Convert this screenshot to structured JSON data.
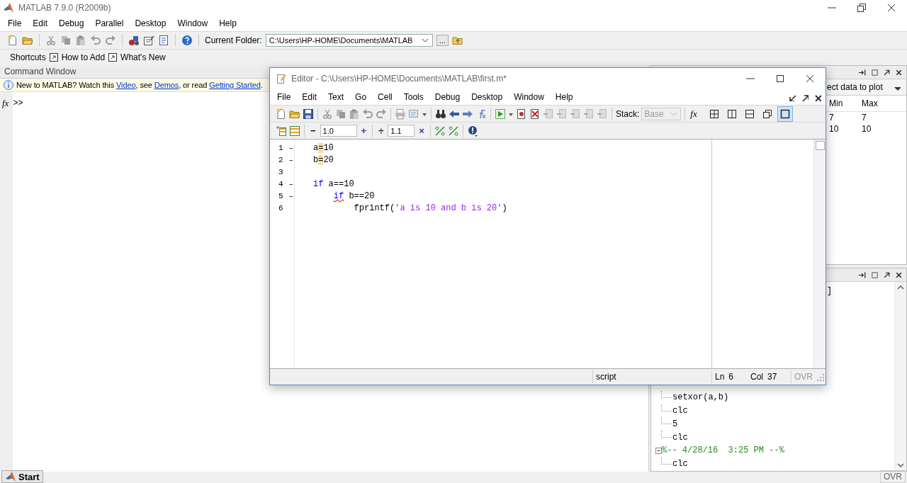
{
  "window": {
    "title": "MATLAB  7.9.0 (R2009b)"
  },
  "menu": [
    "File",
    "Edit",
    "Debug",
    "Parallel",
    "Desktop",
    "Window",
    "Help"
  ],
  "toolbar": {
    "current_folder_label": "Current Folder:",
    "current_folder": "C:\\Users\\HP-HOME\\Documents\\MATLAB",
    "browse": "..."
  },
  "shortcuts": {
    "label": "Shortcuts",
    "items": [
      "How to Add",
      "What's New"
    ]
  },
  "command_window": {
    "title": "Command Window",
    "function_button": "fx",
    "prompt": ">>",
    "notice": [
      {
        "kind": "text",
        "text": "New to MATLAB? Watch this "
      },
      {
        "kind": "link",
        "text": "Video"
      },
      {
        "kind": "text",
        "text": ", see "
      },
      {
        "kind": "link",
        "text": "Demos"
      },
      {
        "kind": "text",
        "text": ", or read "
      },
      {
        "kind": "link",
        "text": "Getting Started"
      },
      {
        "kind": "text",
        "text": "."
      }
    ]
  },
  "workspace": {
    "plot_selector": "ect data to plot",
    "columns": [
      "Min",
      "Max"
    ],
    "rows": [
      [
        "7",
        "7"
      ],
      [
        "10",
        "10"
      ]
    ]
  },
  "history": {
    "fragment": "]",
    "earlier_children": [
      "setxor(a,b)",
      "clc",
      "5",
      "clc"
    ],
    "sessions": [
      {
        "header": "%-- 4/28/16  3:25 PM --%",
        "expanded": true,
        "children": [
          "clc"
        ]
      }
    ]
  },
  "editor": {
    "title": "Editor - C:\\Users\\HP-HOME\\Documents\\MATLAB\\first.m*",
    "menu": [
      "File",
      "Edit",
      "Text",
      "Go",
      "Cell",
      "Tools",
      "Debug",
      "Desktop",
      "Window",
      "Help"
    ],
    "function_button": "fx",
    "stack_label": "Stack:",
    "stack_value": "Base",
    "cell_toolbar": {
      "minus": "−",
      "value1": "1.0",
      "plus": "+",
      "divide": "÷",
      "value2": "1.1",
      "times": "×"
    },
    "layouts": [
      {
        "kind": "grid",
        "selected": false
      },
      {
        "kind": "columns",
        "selected": false
      },
      {
        "kind": "rows",
        "selected": false
      },
      {
        "kind": "float",
        "selected": false
      },
      {
        "kind": "single",
        "selected": true
      }
    ],
    "lines": [
      {
        "number": "1",
        "marker": "–",
        "segments": [
          {
            "kind": "plain",
            "text": "a"
          },
          {
            "kind": "plain",
            "text": "=",
            "flagged": true
          },
          {
            "kind": "plain",
            "text": "10"
          }
        ]
      },
      {
        "number": "2",
        "marker": "–",
        "segments": [
          {
            "kind": "plain",
            "text": "b"
          },
          {
            "kind": "plain",
            "text": "=",
            "flagged": true
          },
          {
            "kind": "plain",
            "text": "20"
          }
        ]
      },
      {
        "number": "3"
      },
      {
        "number": "4",
        "marker": "–",
        "segments": [
          {
            "kind": "keyword",
            "text": "if"
          },
          {
            "kind": "plain",
            "text": " a==10"
          }
        ],
        "children": [
          {
            "number": "5",
            "marker": "–",
            "segments": [
              {
                "kind": "keyword",
                "text": "if",
                "flagged": true
              },
              {
                "kind": "plain",
                "text": " b==20"
              }
            ],
            "children": [
              {
                "number": "6",
                "segments": [
                  {
                    "kind": "plain",
                    "text": "fprintf("
                  },
                  {
                    "kind": "string",
                    "text": "'a is 10 and b is 20'"
                  },
                  {
                    "kind": "plain",
                    "text": ")"
                  }
                ]
              }
            ]
          }
        ]
      }
    ],
    "status": {
      "mode": "script",
      "ln_label": "Ln",
      "ln": "6",
      "col_label": "Col",
      "col": "37",
      "ovr": "OVR"
    }
  },
  "status_bar": {
    "start": "Start",
    "ovr": "OVR"
  }
}
